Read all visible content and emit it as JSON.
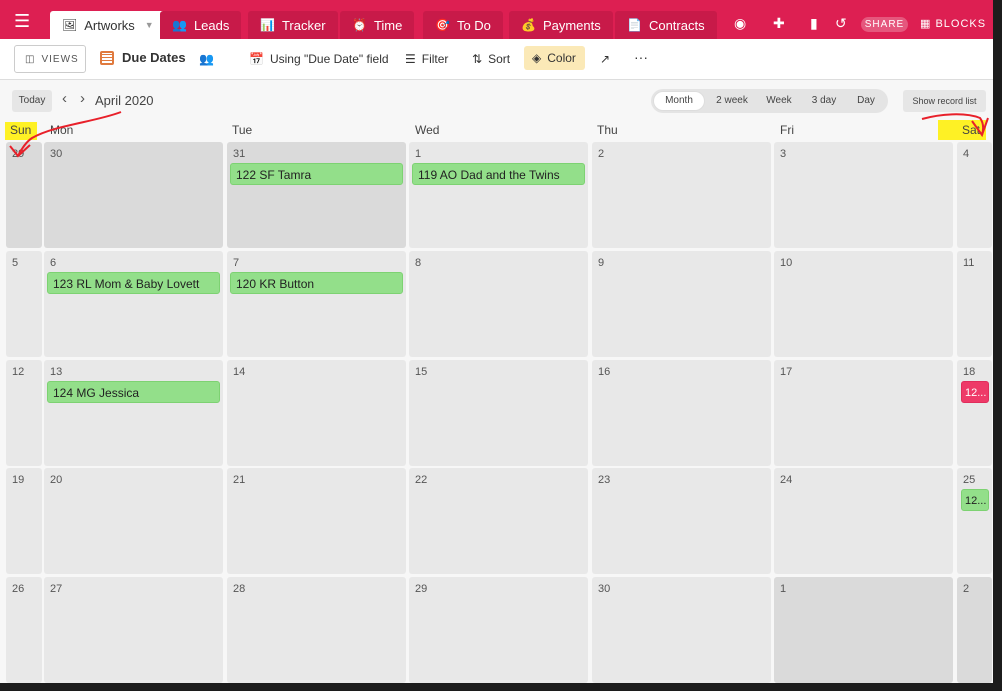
{
  "tabs": [
    {
      "label": "Artworks",
      "icon": "🖼",
      "active": true
    },
    {
      "label": "Leads",
      "icon": "👥"
    },
    {
      "label": "Tracker",
      "icon": "📊"
    },
    {
      "label": "Time",
      "icon": "⏰"
    },
    {
      "label": "To Do",
      "icon": "🎯"
    },
    {
      "label": "Payments",
      "icon": "💰"
    },
    {
      "label": "Contracts",
      "icon": "📄"
    }
  ],
  "topbar": {
    "share_label": "SHARE",
    "blocks_label": "BLOCKS"
  },
  "toolbar": {
    "views_label": "VIEWS",
    "view_name": "Due Dates",
    "date_field_label": "Using \"Due Date\" field",
    "filter_label": "Filter",
    "sort_label": "Sort",
    "color_label": "Color",
    "more_label": "···"
  },
  "calendar": {
    "today_label": "Today",
    "month_title": "April 2020",
    "ranges": [
      "Month",
      "2 week",
      "Week",
      "3 day",
      "Day"
    ],
    "active_range": "Month",
    "show_record_list_label": "Show record list",
    "day_names": [
      "Sun",
      "Mon",
      "Tue",
      "Wed",
      "Thu",
      "Fri",
      "Sat"
    ],
    "weeks": [
      [
        {
          "day": "29",
          "outside": true,
          "events": []
        },
        {
          "day": "30",
          "outside": true,
          "events": []
        },
        {
          "day": "31",
          "outside": true,
          "events": [
            {
              "title": "122 SF Tamra",
              "color": "#93df8a"
            }
          ]
        },
        {
          "day": "1",
          "outside": false,
          "events": [
            {
              "title": "119 AO Dad and the Twins",
              "color": "#93df8a"
            }
          ]
        },
        {
          "day": "2",
          "outside": false,
          "events": []
        },
        {
          "day": "3",
          "outside": false,
          "events": []
        },
        {
          "day": "4",
          "outside": false,
          "events": []
        }
      ],
      [
        {
          "day": "5",
          "outside": false,
          "events": []
        },
        {
          "day": "6",
          "outside": false,
          "events": [
            {
              "title": "123 RL Mom & Baby Lovett",
              "color": "#93df8a"
            }
          ]
        },
        {
          "day": "7",
          "outside": false,
          "events": [
            {
              "title": "120 KR Button",
              "color": "#93df8a"
            }
          ]
        },
        {
          "day": "8",
          "outside": false,
          "events": []
        },
        {
          "day": "9",
          "outside": false,
          "events": []
        },
        {
          "day": "10",
          "outside": false,
          "events": []
        },
        {
          "day": "11",
          "outside": false,
          "events": []
        }
      ],
      [
        {
          "day": "12",
          "outside": false,
          "events": []
        },
        {
          "day": "13",
          "outside": false,
          "events": [
            {
              "title": "124 MG Jessica",
              "color": "#93df8a"
            }
          ]
        },
        {
          "day": "14",
          "outside": false,
          "events": []
        },
        {
          "day": "15",
          "outside": false,
          "events": []
        },
        {
          "day": "16",
          "outside": false,
          "events": []
        },
        {
          "day": "17",
          "outside": false,
          "events": []
        },
        {
          "day": "18",
          "outside": false,
          "events": [
            {
              "title": "12...",
              "color": "#ee3a68"
            }
          ]
        }
      ],
      [
        {
          "day": "19",
          "outside": false,
          "events": []
        },
        {
          "day": "20",
          "outside": false,
          "events": []
        },
        {
          "day": "21",
          "outside": false,
          "events": []
        },
        {
          "day": "22",
          "outside": false,
          "events": []
        },
        {
          "day": "23",
          "outside": false,
          "events": []
        },
        {
          "day": "24",
          "outside": false,
          "events": []
        },
        {
          "day": "25",
          "outside": false,
          "events": [
            {
              "title": "12...",
              "color": "#93df8a"
            }
          ]
        }
      ],
      [
        {
          "day": "26",
          "outside": false,
          "events": []
        },
        {
          "day": "27",
          "outside": false,
          "events": []
        },
        {
          "day": "28",
          "outside": false,
          "events": []
        },
        {
          "day": "29",
          "outside": false,
          "events": []
        },
        {
          "day": "30",
          "outside": false,
          "events": []
        },
        {
          "day": "1",
          "outside": true,
          "events": []
        },
        {
          "day": "2",
          "outside": true,
          "events": []
        }
      ]
    ]
  },
  "colors": {
    "brand": "#dd1f52",
    "event_green": "#93df8a",
    "event_pink": "#ee3a68",
    "annotation_red": "#e8202a",
    "annotation_yellow": "#fff000"
  }
}
